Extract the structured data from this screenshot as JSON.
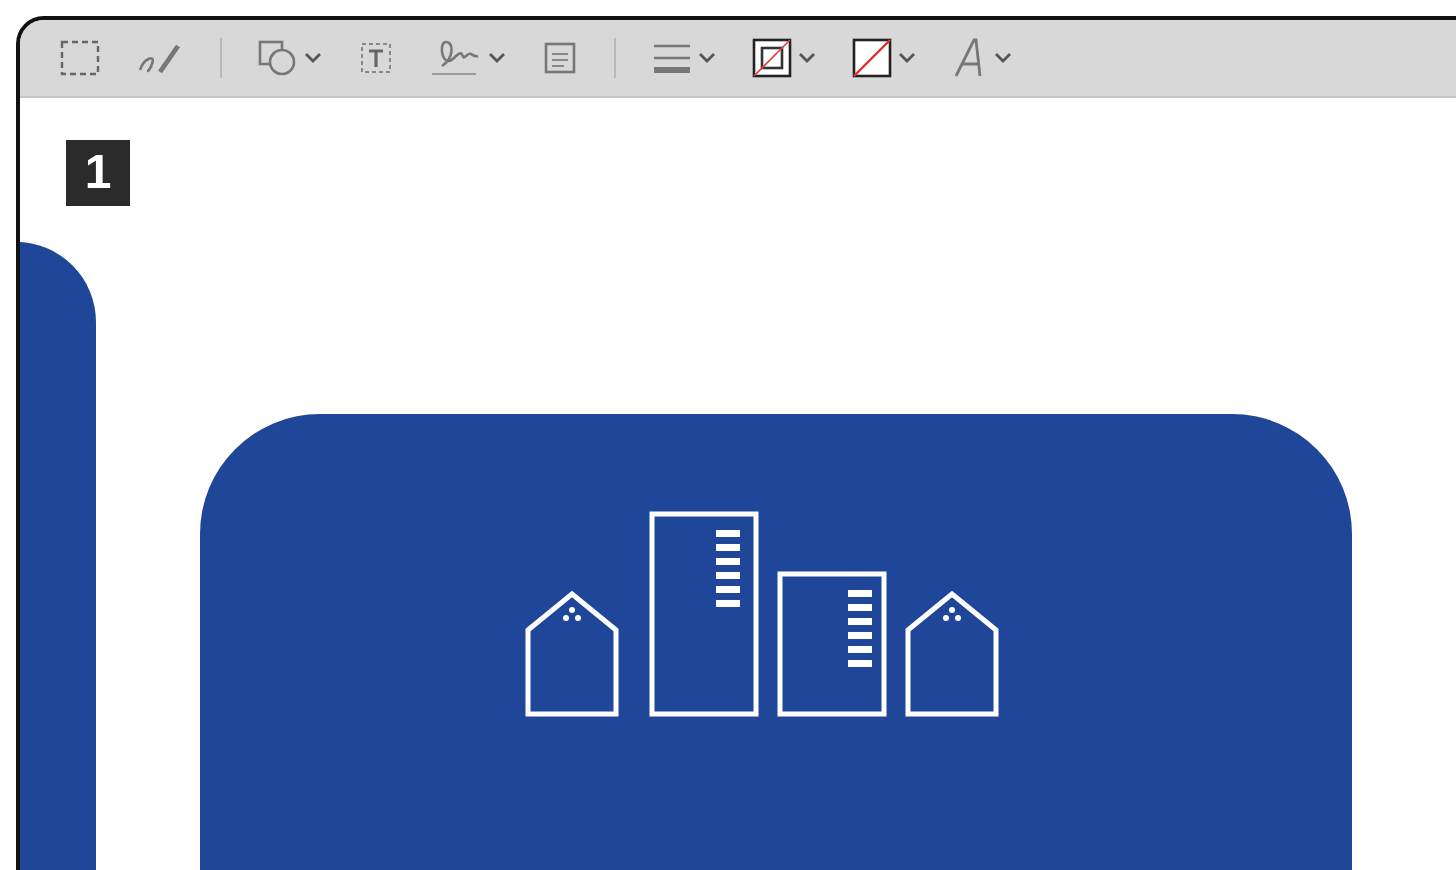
{
  "page_badge": "1"
}
